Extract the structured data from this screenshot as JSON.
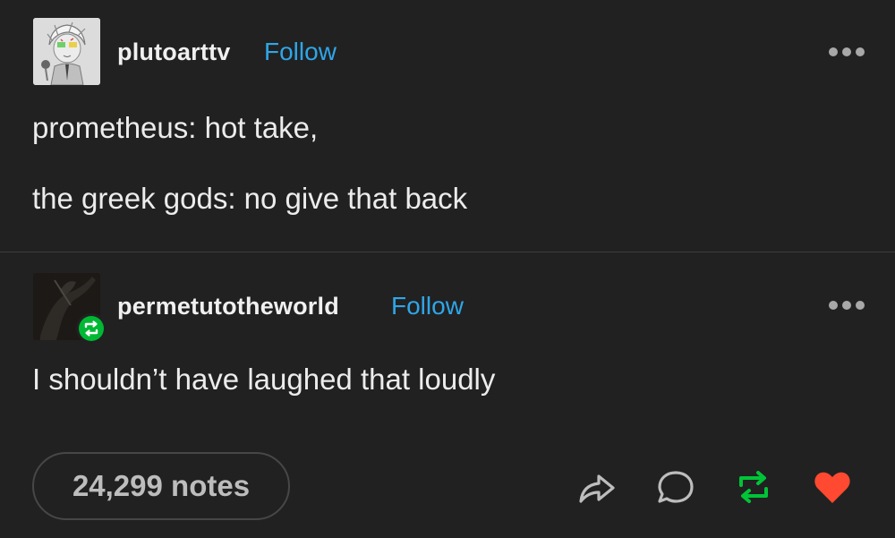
{
  "post": {
    "original": {
      "username": "plutoarttv",
      "follow_label": "Follow",
      "lines": [
        "prometheus: hot take,",
        "the greek gods: no give that back"
      ]
    },
    "reblog": {
      "username": "permetutotheworld",
      "follow_label": "Follow",
      "lines": [
        "I shouldn’t have laughed that loudly"
      ]
    },
    "footer": {
      "notes_label": "24,299 notes"
    }
  },
  "colors": {
    "background": "#212121",
    "follow_blue": "#2fa6e8",
    "reblog_green": "#00b833",
    "like_red": "#ff4930"
  },
  "icons": {
    "more": "more-dots-icon",
    "share": "share-arrow-icon",
    "reply": "reply-bubble-icon",
    "reblog": "reblog-icon",
    "like": "heart-icon"
  }
}
